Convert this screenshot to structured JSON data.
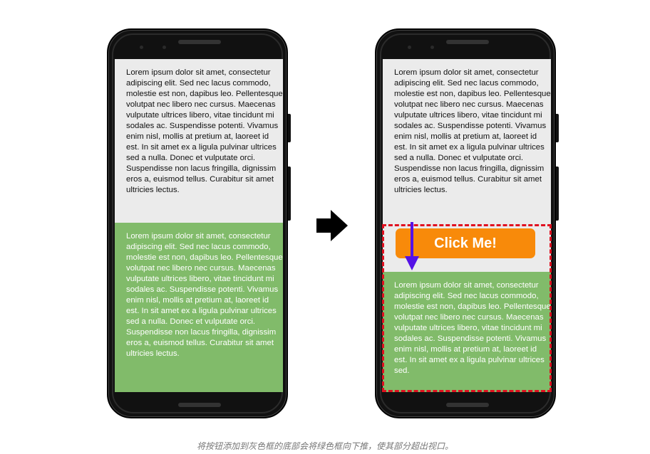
{
  "lorem_text": "Lorem ipsum dolor sit amet, consectetur adipiscing elit. Sed nec lacus commodo, molestie est non, dapibus leo. Pellentesque volutpat nec libero nec cursus. Maecenas vulputate ultrices libero, vitae tincidunt mi sodales ac. Suspendisse potenti. Vivamus enim nisl, mollis at pretium at, laoreet id est. In sit amet ex a ligula pulvinar ultrices sed a nulla. Donec et vulputate orci. Suspendisse non lacus fringilla, dignissim eros a, euismod tellus. Curabitur sit amet ultricies lectus.",
  "lorem_text_truncated": "Lorem ipsum dolor sit amet, consectetur adipiscing elit. Sed nec lacus commodo, molestie est non, dapibus leo. Pellentesque volutpat nec libero nec cursus. Maecenas vulputate ultrices libero, vitae tincidunt mi sodales ac. Suspendisse potenti. Vivamus enim nisl, mollis at pretium at, laoreet id est. In sit amet ex a ligula pulvinar ultrices sed.",
  "button_label": "Click Me!",
  "caption": "将按钮添加到灰色框的底部会将绿色框向下推，使其部分超出视口。",
  "colors": {
    "grey_box": "#ebebeb",
    "green_box": "#81bb6a",
    "button": "#f88a0a",
    "arrow": "#5512e6",
    "dashed_outline": "#e01020"
  }
}
